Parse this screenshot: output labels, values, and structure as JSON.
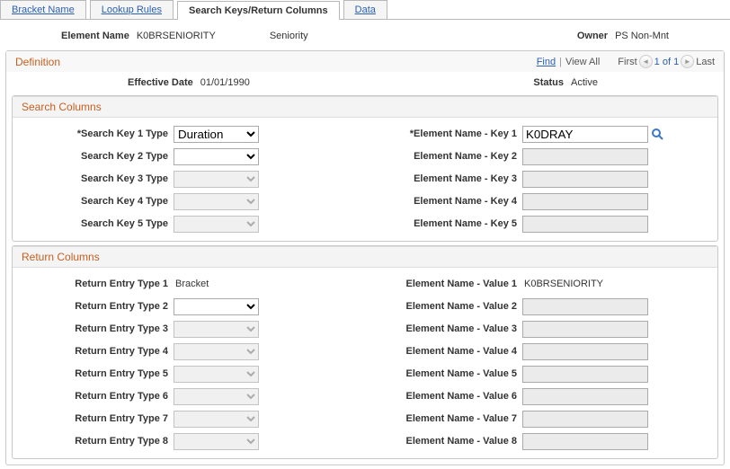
{
  "tabs": [
    {
      "label": "Bracket Name",
      "u": "B"
    },
    {
      "label": "Lookup Rules",
      "u": "L"
    },
    {
      "label": "Search Keys/Return Columns",
      "u": "S"
    },
    {
      "label": "Data",
      "u": "D"
    }
  ],
  "active_tab": 2,
  "header": {
    "element_name_lbl": "Element Name",
    "element_name_val": "K0BRSENIORITY",
    "element_desc": "Seniority",
    "owner_lbl": "Owner",
    "owner_val": "PS Non-Mnt"
  },
  "definition": {
    "title": "Definition",
    "find": "Find",
    "view_all": "View All",
    "first": "First",
    "pos": "1 of 1",
    "last": "Last",
    "eff_date_lbl": "Effective Date",
    "eff_date_val": "01/01/1990",
    "status_lbl": "Status",
    "status_val": "Active"
  },
  "search": {
    "title": "Search Columns",
    "left": [
      {
        "lbl": "*Search Key 1 Type",
        "val": "Duration",
        "enabled": true
      },
      {
        "lbl": "Search Key 2 Type",
        "val": "",
        "enabled": true
      },
      {
        "lbl": "Search Key 3 Type",
        "val": "",
        "enabled": false
      },
      {
        "lbl": "Search Key 4 Type",
        "val": "",
        "enabled": false
      },
      {
        "lbl": "Search Key 5 Type",
        "val": "",
        "enabled": false
      }
    ],
    "right": [
      {
        "lbl": "*Element Name - Key 1",
        "val": "K0DRAY",
        "enabled": true,
        "lookup": true
      },
      {
        "lbl": "Element Name - Key 2",
        "val": "",
        "enabled": false
      },
      {
        "lbl": "Element Name - Key 3",
        "val": "",
        "enabled": false
      },
      {
        "lbl": "Element Name - Key 4",
        "val": "",
        "enabled": false
      },
      {
        "lbl": "Element Name - Key 5",
        "val": "",
        "enabled": false
      }
    ]
  },
  "return": {
    "title": "Return Columns",
    "left": [
      {
        "lbl": "Return Entry Type 1",
        "val": "Bracket",
        "readonly": true
      },
      {
        "lbl": "Return Entry Type 2",
        "val": "",
        "enabled": true
      },
      {
        "lbl": "Return Entry Type 3",
        "val": "",
        "enabled": false
      },
      {
        "lbl": "Return Entry Type 4",
        "val": "",
        "enabled": false
      },
      {
        "lbl": "Return Entry Type 5",
        "val": "",
        "enabled": false
      },
      {
        "lbl": "Return Entry Type 6",
        "val": "",
        "enabled": false
      },
      {
        "lbl": "Return Entry Type 7",
        "val": "",
        "enabled": false
      },
      {
        "lbl": "Return Entry Type 8",
        "val": "",
        "enabled": false
      }
    ],
    "right": [
      {
        "lbl": "Element Name - Value 1",
        "val": "K0BRSENIORITY",
        "readonly": true
      },
      {
        "lbl": "Element Name - Value 2",
        "val": "",
        "enabled": false
      },
      {
        "lbl": "Element Name - Value 3",
        "val": "",
        "enabled": false
      },
      {
        "lbl": "Element Name - Value 4",
        "val": "",
        "enabled": false
      },
      {
        "lbl": "Element Name - Value 5",
        "val": "",
        "enabled": false
      },
      {
        "lbl": "Element Name - Value 6",
        "val": "",
        "enabled": false
      },
      {
        "lbl": "Element Name - Value 7",
        "val": "",
        "enabled": false
      },
      {
        "lbl": "Element Name - Value 8",
        "val": "",
        "enabled": false
      }
    ]
  }
}
